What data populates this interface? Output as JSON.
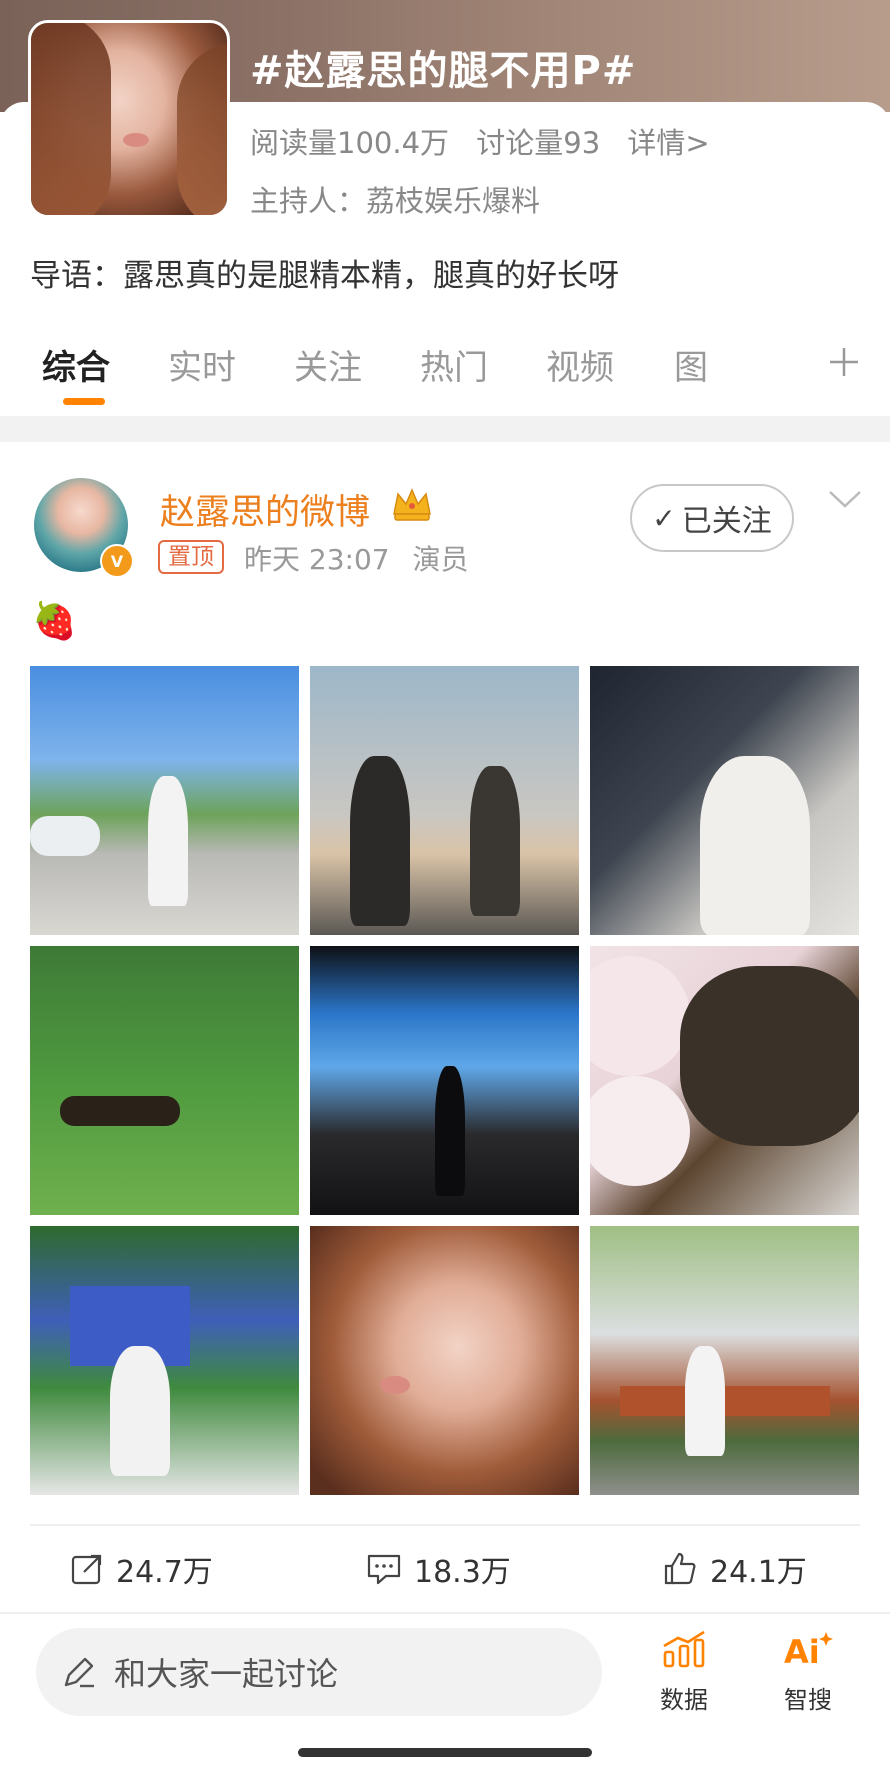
{
  "topic": {
    "title": "#赵露思的腿不用P#",
    "reads": "阅读量100.4万",
    "discussions": "讨论量93",
    "details_link": "详情>",
    "host": "主持人：荔枝娱乐爆料",
    "intro": "导语：露思真的是腿精本精，腿真的好长呀"
  },
  "tabs": [
    "综合",
    "实时",
    "关注",
    "热门",
    "视频",
    "图"
  ],
  "post": {
    "author": "赵露思的微博",
    "pinned_badge": "置顶",
    "time": "昨天 23:07",
    "source": "演员",
    "follow_label": "已关注",
    "body_emoji": "🍓",
    "reposts": "24.7万",
    "comments": "18.3万",
    "likes": "24.1万"
  },
  "bottom": {
    "compose_placeholder": "和大家一起讨论",
    "data_label": "数据",
    "ai_search_label": "智搜"
  },
  "colors": {
    "accent_orange": "#ff8200",
    "author_orange": "#ec7f1e",
    "pinned_red": "#e46a42"
  }
}
